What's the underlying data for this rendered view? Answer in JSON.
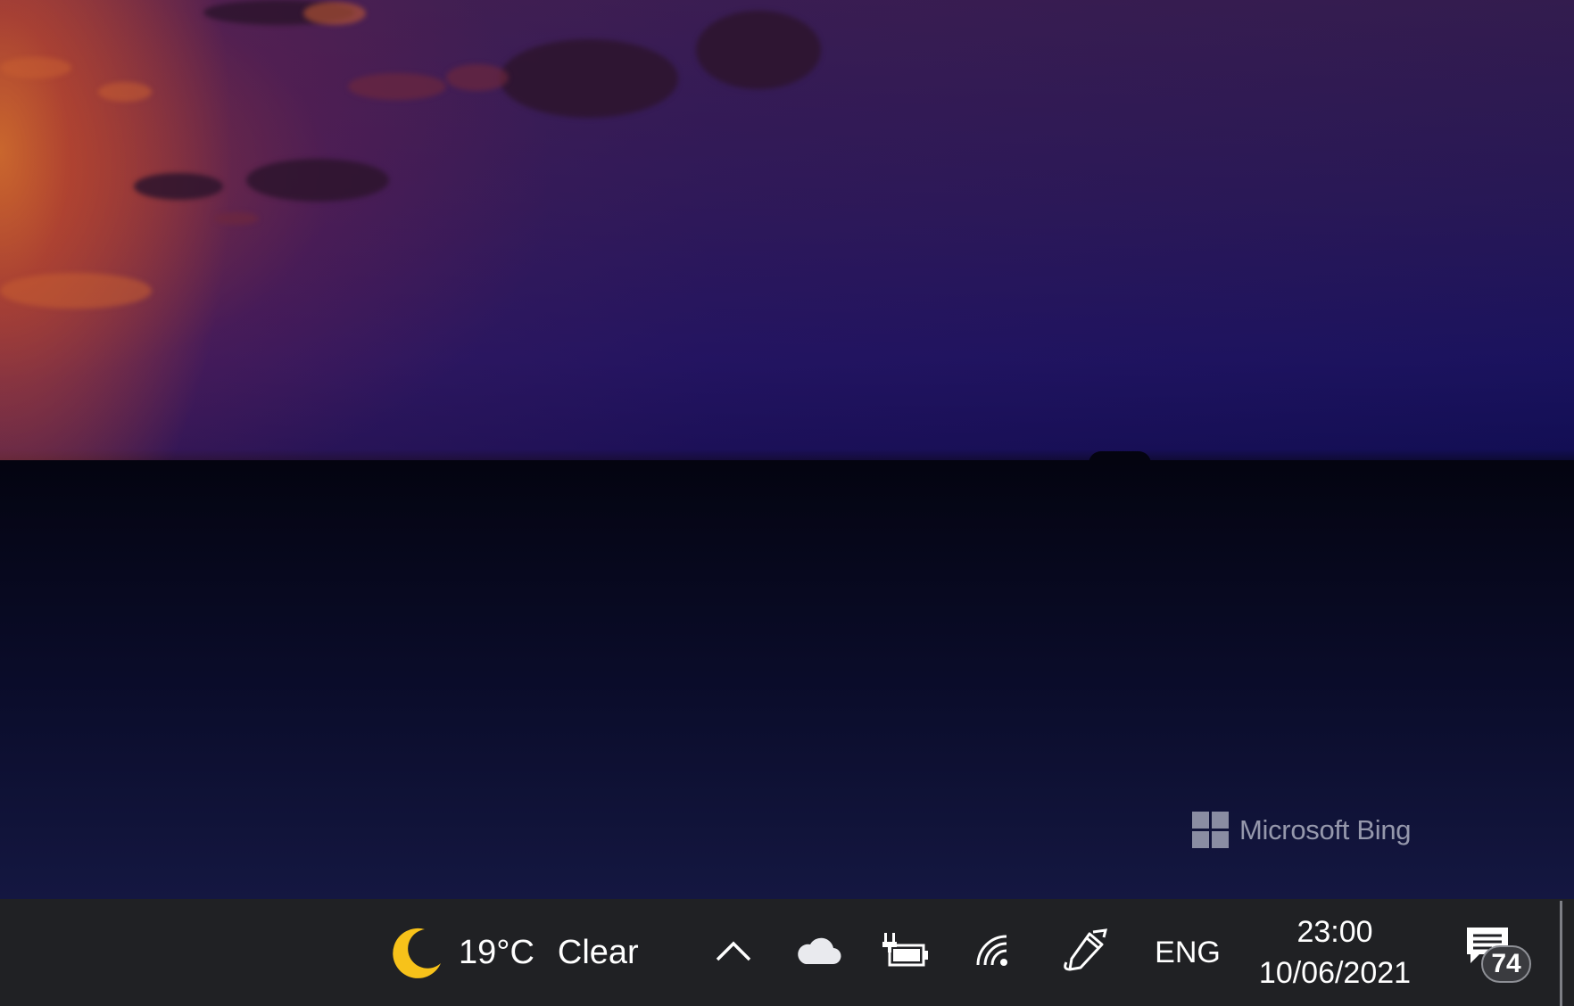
{
  "wallpaper": {
    "watermark_text": "Microsoft Bing"
  },
  "taskbar": {
    "weather": {
      "icon": "moon-icon",
      "temperature": "19°C",
      "condition": "Clear"
    },
    "tray": {
      "chevron_icon": "chevron-up-icon",
      "onedrive_icon": "cloud-icon",
      "battery_icon": "battery-charging-icon",
      "wifi_icon": "wifi-icon",
      "pen_icon": "pen-icon"
    },
    "language": "ENG",
    "clock": {
      "time": "23:00",
      "date": "10/06/2021"
    },
    "notifications": {
      "icon": "message-icon",
      "count": "74"
    }
  },
  "colors": {
    "taskbar_bg": "#202124",
    "moon": "#f7c21a",
    "badge_bg": "#3a3b3f"
  }
}
